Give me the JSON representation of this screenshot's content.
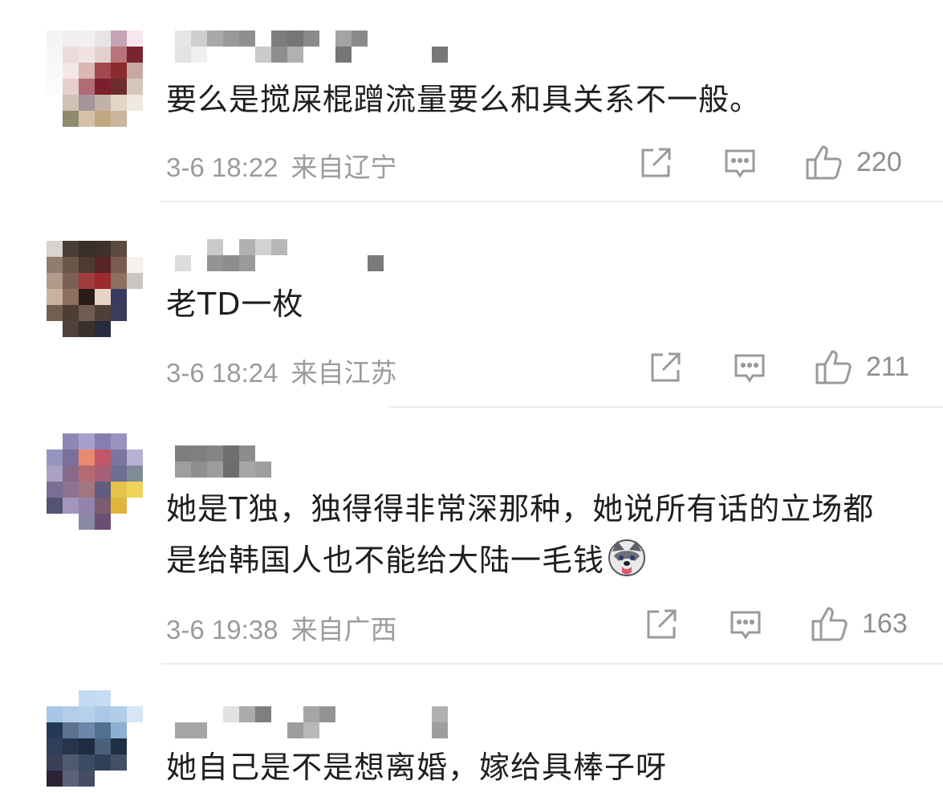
{
  "comments": [
    {
      "text": "要么是搅屎棍蹭流量要么和具关系不一般。",
      "time": "3-6 18:22",
      "location": "来自辽宁",
      "likes": "220",
      "avatar_pixels": [
        "#f4f4f4",
        "#f0eeee",
        "#f1eff0",
        "#e8e4e6",
        "#c6a4b3",
        "#f7e6ee",
        "#f7f7f7",
        "#eadcdc",
        "#f1e3e3",
        "#e4d1cf",
        "#b9737a",
        "#7a2231",
        "#f8f8f8",
        "#f2e8e8",
        "#d8b7b5",
        "#a2484f",
        "#8a2c2e",
        "#c9a8a4",
        "#fbfbfb",
        "#e6cfcf",
        "#b36b75",
        "#7c1f2c",
        "#6f2c2d",
        "#d6c7bd",
        "#ffffff",
        "#cfc2b4",
        "#a6959b",
        "#c2b2a6",
        "#e3d6c4",
        "#efe8de",
        "#ffffff",
        "#8d8a6d",
        "#d6c0a8",
        "#c2a77f",
        "#cbb59d",
        "#ffffff"
      ],
      "name_pixels": [
        "#e6e6e6",
        "#cfcfcf",
        "#a9a9a9",
        "#9a9a9a",
        "#8f8f8f",
        "#ffffff",
        "#7d7d7d",
        "#767676",
        "#8a8a8a",
        "#ffffff",
        "#a3a3a3",
        "#8a8a8a",
        "#ffffff",
        "#ffffff",
        "#ffffff",
        "#ffffff",
        "#ffffff",
        "#e3e3e3",
        "#f0f0f0",
        "#ffffff",
        "#ffffff",
        "#ffffff",
        "#c9c9c9",
        "#8e8e8e",
        "#b1b1b1",
        "#ffffff",
        "#ffffff",
        "#767676",
        "#ffffff",
        "#ffffff",
        "#ffffff",
        "#ffffff",
        "#ffffff",
        "#777777"
      ]
    },
    {
      "text": "老TD一枚",
      "time": "3-6 18:24",
      "location": "来自江苏",
      "likes": "211",
      "avatar_pixels": [
        "#d8d3cf",
        "#4a3d36",
        "#3a2f29",
        "#3d3129",
        "#5c4a3e",
        "#ffffff",
        "#8f7d6f",
        "#6b574a",
        "#4d3a33",
        "#5a2326",
        "#7a5d4f",
        "#f4f1ee",
        "#b09a8a",
        "#7a5f52",
        "#a03c3e",
        "#9b2b2c",
        "#8c7060",
        "#c9c6c0",
        "#c8b3a2",
        "#8c6f5d",
        "#2a1d19",
        "#e8d4c6",
        "#383a5f",
        "#ffffff",
        "#715f52",
        "#4e3d33",
        "#705c50",
        "#4f3f37",
        "#3b3c5c",
        "#ffffff",
        "#ffffff",
        "#504039",
        "#3b2f2a",
        "#282a3e",
        "#ffffff",
        "#ffffff"
      ],
      "name_pixels": [
        "#ffffff",
        "#ffffff",
        "#c9c9c9",
        "#ffffff",
        "#b1b1b1",
        "#d2d2d2",
        "#b7b7b7",
        "#ffffff",
        "#ffffff",
        "#ffffff",
        "#ffffff",
        "#ffffff",
        "#ffffff",
        "#ffffff",
        "#ffffff",
        "#ffffff",
        "#ffffff",
        "#dcdcdc",
        "#ffffff",
        "#939393",
        "#8d8d8d",
        "#9a9a9a",
        "#ffffff",
        "#ffffff",
        "#ffffff",
        "#ffffff",
        "#ffffff",
        "#ffffff",
        "#ffffff",
        "#7a7a7a",
        "#ffffff",
        "#ffffff",
        "#ffffff",
        "#ffffff"
      ]
    },
    {
      "text": "她是T独，独得得非常深那种，她说所有话的立场都是给韩国人也不能给大陆一毛钱",
      "time": "3-6 19:38",
      "location": "来自广西",
      "likes": "163",
      "avatar_pixels": [
        "#ffffff",
        "#8e88b4",
        "#a89fcf",
        "#857fb0",
        "#9a93c2",
        "#ffffff",
        "#9794bf",
        "#7b6f9d",
        "#e88a6e",
        "#c2566a",
        "#7e74a3",
        "#b6b2d1",
        "#a9a2c4",
        "#866a8a",
        "#b76a72",
        "#a66076",
        "#6e6d93",
        "#7f8b97",
        "#7a6e96",
        "#8d7391",
        "#a2767f",
        "#5f5d80",
        "#e3c34b",
        "#f2d35a",
        "#545372",
        "#a196bf",
        "#9383ad",
        "#7c5c70",
        "#e0b43d",
        "#ffffff",
        "#ffffff",
        "#ffffff",
        "#8a8aa6",
        "#6a4f74",
        "#ffffff",
        "#ffffff"
      ],
      "name_pixels": [
        "#7e7e7e",
        "#808080",
        "#858585",
        "#6f6f6f",
        "#8c8c8c",
        "#ffffff",
        "#ffffff",
        "#ffffff",
        "#ffffff",
        "#ffffff",
        "#ffffff",
        "#ffffff",
        "#ffffff",
        "#ffffff",
        "#ffffff",
        "#ffffff",
        "#ffffff",
        "#9e9e9e",
        "#8e8e8e",
        "#9c9c9c",
        "#6d6d6d",
        "#a6a6a6",
        "#9e9e9e",
        "#ffffff",
        "#ffffff",
        "#ffffff",
        "#ffffff",
        "#ffffff",
        "#ffffff",
        "#ffffff",
        "#ffffff",
        "#ffffff",
        "#ffffff",
        "#ffffff"
      ]
    },
    {
      "text": "她自己是不是想离婚，嫁给具棒子呀",
      "avatar_pixels": [
        "#ffffff",
        "#ffffff",
        "#c3daf2",
        "#c6dcf2",
        "#ffffff",
        "#ffffff",
        "#a8c6e6",
        "#b3cdea",
        "#b7d0ea",
        "#aac8e6",
        "#b0cde9",
        "#d7e6f5",
        "#243a58",
        "#5c7290",
        "#6c87a8",
        "#51708f",
        "#8bb0d4",
        "#ffffff",
        "#2d3f5a",
        "#26354c",
        "#1e2c40",
        "#4a5f79",
        "#203044",
        "#ffffff",
        "#3a3f56",
        "#4f5970",
        "#3a4c63",
        "#304057",
        "#424f64",
        "#ffffff",
        "#2b2436",
        "#5b6278",
        "#444d63",
        "#ffffff",
        "#ffffff",
        "#ffffff"
      ],
      "name_pixels": [
        "#ffffff",
        "#ffffff",
        "#ffffff",
        "#e2e2e2",
        "#ababab",
        "#7f7f7f",
        "#ffffff",
        "#ffffff",
        "#a6a6a6",
        "#939393",
        "#ffffff",
        "#ffffff",
        "#ffffff",
        "#ffffff",
        "#ffffff",
        "#ffffff",
        "#b0b0b0",
        "#a6a6a6",
        "#a6a6a6",
        "#ffffff",
        "#ffffff",
        "#ffffff",
        "#ffffff",
        "#ffffff",
        "#9d9d9d",
        "#b8b8b8",
        "#ffffff",
        "#ffffff",
        "#ffffff",
        "#ffffff",
        "#ffffff",
        "#ffffff",
        "#ffffff",
        "#9e9e9e"
      ]
    }
  ],
  "icons": {
    "share": "share-icon",
    "reply": "comment-icon",
    "like": "thumbs-up-icon",
    "emoji": "husky-emoji-icon"
  }
}
